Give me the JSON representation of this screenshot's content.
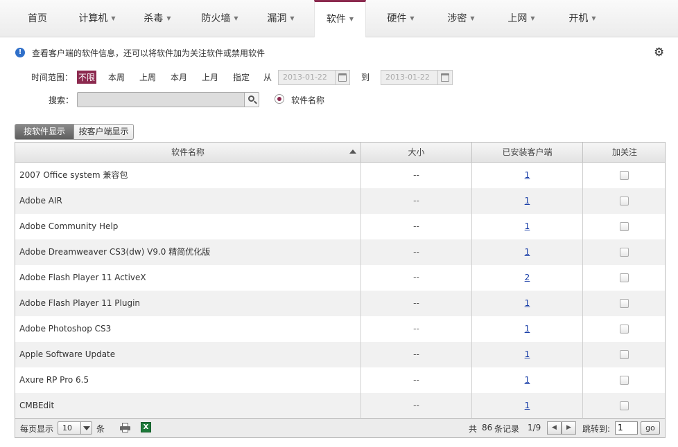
{
  "nav": {
    "items": [
      {
        "label": "首页",
        "has_caret": false
      },
      {
        "label": "计算机",
        "has_caret": true
      },
      {
        "label": "杀毒",
        "has_caret": true
      },
      {
        "label": "防火墙",
        "has_caret": true
      },
      {
        "label": "漏洞",
        "has_caret": true
      },
      {
        "label": "软件",
        "has_caret": true,
        "active": true
      },
      {
        "label": "硬件",
        "has_caret": true
      },
      {
        "label": "涉密",
        "has_caret": true
      },
      {
        "label": "上网",
        "has_caret": true
      },
      {
        "label": "开机",
        "has_caret": true
      }
    ],
    "active_color": "#8c2a4f"
  },
  "info": {
    "text": "查看客户端的软件信息，还可以将软件加为关注软件或禁用软件",
    "icon": "info-icon",
    "settings_icon": "gear-icon"
  },
  "filter": {
    "time_label": "时间范围：",
    "time_options": [
      "不限",
      "本周",
      "上周",
      "本月",
      "上月",
      "指定"
    ],
    "active_option": "不限",
    "from_label": "从",
    "to_label": "到",
    "from_date": "2013-01-22",
    "to_date": "2013-01-22",
    "search_label": "搜索：",
    "search_value": "",
    "radio_label": "软件名称"
  },
  "view_toggle": {
    "by_software": "按软件显示",
    "by_client": "按客户端显示"
  },
  "table": {
    "columns": [
      "软件名称",
      "大小",
      "已安装客户端",
      "加关注"
    ],
    "rows": [
      {
        "name": "2007 Office system 兼容包",
        "size": "--",
        "count": "1"
      },
      {
        "name": "Adobe AIR",
        "size": "--",
        "count": "1"
      },
      {
        "name": "Adobe Community Help",
        "size": "--",
        "count": "1"
      },
      {
        "name": "Adobe Dreamweaver CS3(dw) V9.0 精简优化版",
        "size": "--",
        "count": "1"
      },
      {
        "name": "Adobe Flash Player 11 ActiveX",
        "size": "--",
        "count": "2"
      },
      {
        "name": "Adobe Flash Player 11 Plugin",
        "size": "--",
        "count": "1"
      },
      {
        "name": "Adobe Photoshop CS3",
        "size": "--",
        "count": "1"
      },
      {
        "name": "Apple Software Update",
        "size": "--",
        "count": "1"
      },
      {
        "name": "Axure RP Pro 6.5",
        "size": "--",
        "count": "1"
      },
      {
        "name": "CMBEdit",
        "size": "--",
        "count": "1"
      }
    ]
  },
  "footer": {
    "per_page_label": "每页显示",
    "per_page_value": "10",
    "per_page_unit": "条",
    "total_prefix": "共",
    "total_count": "86",
    "total_suffix": "条记录",
    "page_info": "1/9",
    "jump_label": "跳转到:",
    "jump_value": "1",
    "go_label": "go"
  }
}
